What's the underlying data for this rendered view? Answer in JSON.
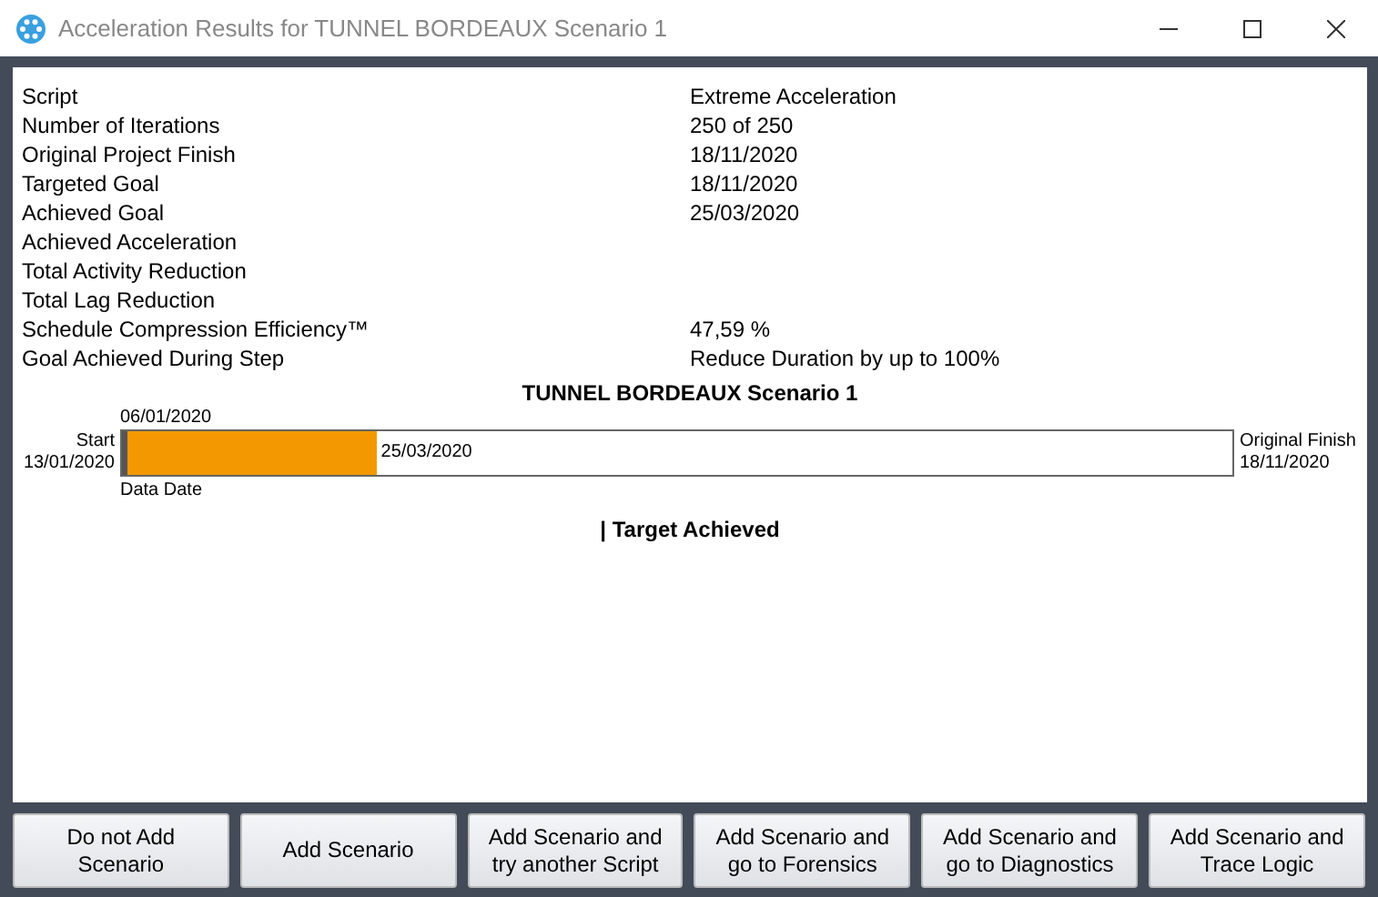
{
  "window": {
    "title": "Acceleration Results for TUNNEL BORDEAUX Scenario 1"
  },
  "summary": [
    {
      "label": "Script",
      "value": "Extreme Acceleration"
    },
    {
      "label": "Number of Iterations",
      "value": "250 of 250"
    },
    {
      "label": "Original Project Finish",
      "value": "18/11/2020"
    },
    {
      "label": "Targeted Goal",
      "value": "18/11/2020"
    },
    {
      "label": "Achieved Goal",
      "value": "25/03/2020"
    },
    {
      "label": "Achieved Acceleration"
    },
    {
      "label": "Total Activity Reduction"
    },
    {
      "label": "Total Lag Reduction"
    },
    {
      "label": "Schedule Compression Efficiency™",
      "value": "47,59 %"
    },
    {
      "label": "Goal Achieved During Step",
      "value": "Reduce Duration by up to 100%"
    }
  ],
  "timeline": {
    "title": "TUNNEL BORDEAUX Scenario 1",
    "data_date": "06/01/2020",
    "start_label": "Start",
    "start_date": "13/01/2020",
    "achieved_date": "25/03/2020",
    "level": 0.23,
    "finish_label": "Original Finish",
    "finish_date": "18/11/2020",
    "data_date_label": "Data Date",
    "status": "| Target Achieved"
  },
  "buttons": [
    "Do not Add Scenario",
    "Add Scenario",
    "Add Scenario and try another Script",
    "Add Scenario and go to Forensics",
    "Add Scenario and go to Diagnostics",
    "Add Scenario and Trace Logic"
  ]
}
